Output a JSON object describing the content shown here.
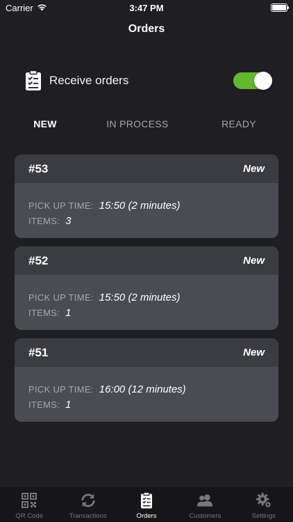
{
  "status_bar": {
    "carrier": "Carrier",
    "time": "3:47 PM"
  },
  "nav": {
    "title": "Orders"
  },
  "receive_orders": {
    "label": "Receive orders",
    "enabled": true,
    "toggle_color": "#63b82f"
  },
  "filter_tabs": [
    {
      "label": "NEW",
      "active": true
    },
    {
      "label": "IN PROCESS",
      "active": false
    },
    {
      "label": "READY",
      "active": false
    }
  ],
  "orders": [
    {
      "number": "#53",
      "status": "New",
      "pickup_label": "PICK UP TIME:",
      "pickup_value": "15:50 (2 minutes)",
      "items_label": "ITEMS:",
      "items_value": "3"
    },
    {
      "number": "#52",
      "status": "New",
      "pickup_label": "PICK UP TIME:",
      "pickup_value": "15:50 (2 minutes)",
      "items_label": "ITEMS:",
      "items_value": "1"
    },
    {
      "number": "#51",
      "status": "New",
      "pickup_label": "PICK UP TIME:",
      "pickup_value": "16:00 (12 minutes)",
      "items_label": "ITEMS:",
      "items_value": "1"
    }
  ],
  "tab_bar": [
    {
      "label": "QR Code",
      "icon": "qr-code-icon",
      "active": false
    },
    {
      "label": "Transactions",
      "icon": "refresh-icon",
      "active": false
    },
    {
      "label": "Orders",
      "icon": "clipboard-icon",
      "active": true
    },
    {
      "label": "Customers",
      "icon": "users-icon",
      "active": false
    },
    {
      "label": "Settings",
      "icon": "gear-icon",
      "active": false
    }
  ]
}
